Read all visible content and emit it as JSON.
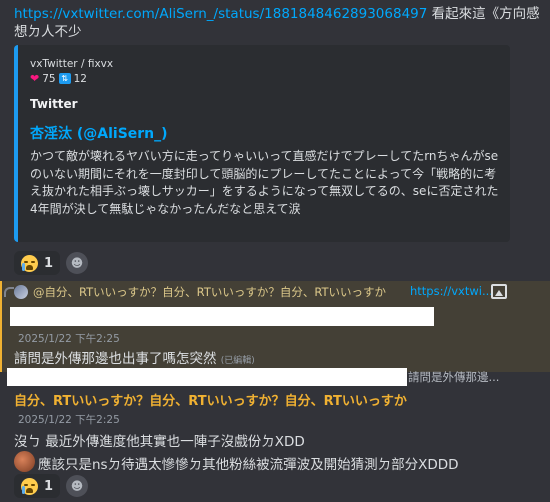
{
  "message_top": {
    "link": "https://vxtwitter.com/AliSern_/status/1881848462893068497",
    "text_after_link": " 看起來這《方向感",
    "text_line2": "想ㄉ人不少"
  },
  "embed": {
    "provider": "vxTwitter / fixvx",
    "likes": "75",
    "retweets": "12",
    "title": "Twitter",
    "author": "杏淫汰 (@AliSern_)",
    "description": "かつて敵が壊れるヤバい方に走ってりゃいいって直感だけでプレーしてたrnちゃんがseのいない期間にそれを一度封印して頭脳的にプレーしてたことによって今「戦略的に考え抜かれた相手ぶっ壊しサッカー」をするようになって無双してるの、seに否定された4年間が決して無駄じゃなかったんだなと思えて涙"
  },
  "reactions_1": {
    "cry_emoji_name": "loudly-crying-face",
    "count": "1"
  },
  "reply_preview": {
    "text": "@自分、RTいいっすか？自分、RTいいっすか？自分、RTいいっすか",
    "link": "https://vxtwi..."
  },
  "message_2": {
    "timestamp": "2025/1/22 下午2:25",
    "text": "請問是外傳那邊也出事了嗎怎突然",
    "edited": "(已編輯)"
  },
  "message_3": {
    "trailing_text": "請問是外傳那邊...",
    "quote": "自分、RTいいっすか？自分、RTいいっすか？自分、RTいいっすか",
    "timestamp": "2025/1/22 下午2:25",
    "line1": "沒ㄅ 最近外傳進度他其實也一陣子沒戲份ㄉXDD",
    "line2": "應該只是nsㄉ待遇太慘慘ㄉ其他粉絲被流彈波及開始猜測ㄉ部分XDDD"
  },
  "reactions_2": {
    "count": "1"
  },
  "colors": {
    "background": "#323339",
    "embed_bg": "#2b2d31",
    "embed_border": "#1d9bf0",
    "link": "#00a8fc",
    "mention_highlight": "#444036",
    "mention_accent": "#f0b132"
  }
}
